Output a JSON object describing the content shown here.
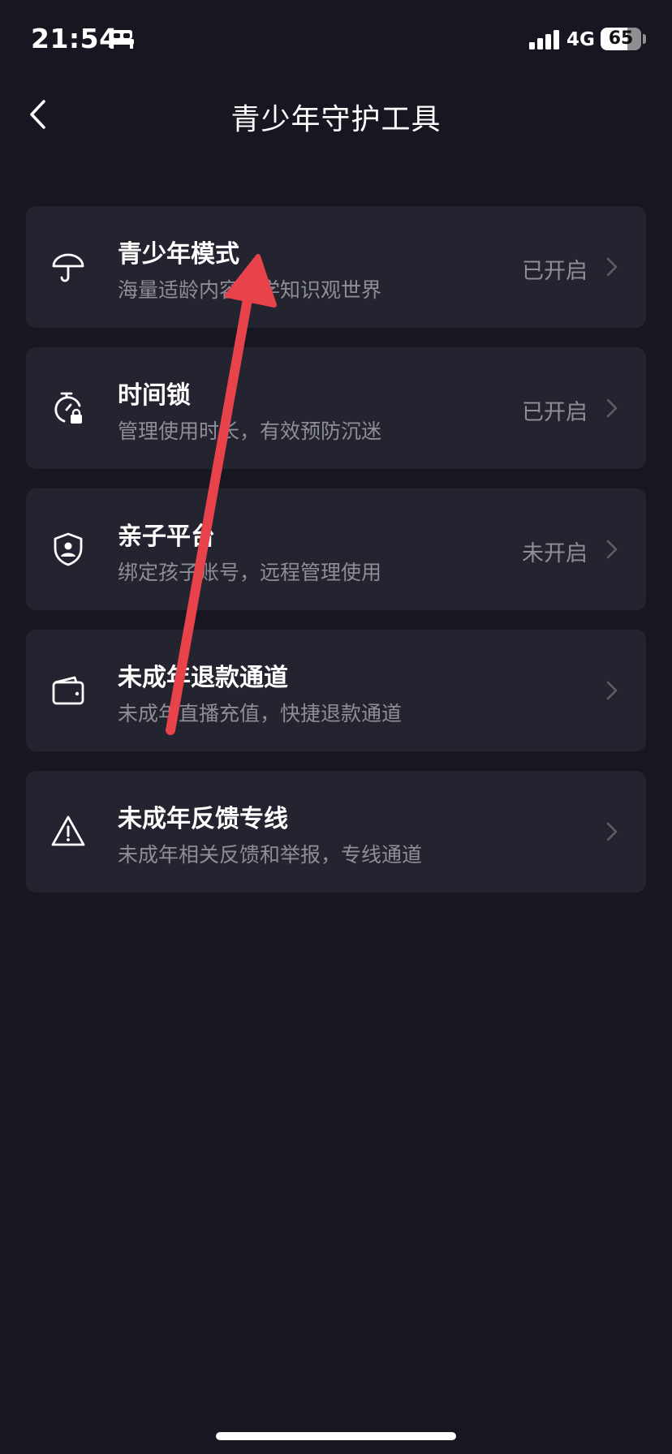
{
  "status_bar": {
    "time": "21:54",
    "network": "4G",
    "battery_level": "65",
    "battery_percent": 65,
    "icons": [
      "bed-icon",
      "cellular-signal-icon",
      "battery-icon"
    ]
  },
  "nav": {
    "back_icon": "chevron-left-icon",
    "title": "青少年守护工具"
  },
  "tools": [
    {
      "icon": "umbrella-icon",
      "title": "青少年模式",
      "description": "海量适龄内容…学知识观世界",
      "status": "已开启"
    },
    {
      "icon": "timer-lock-icon",
      "title": "时间锁",
      "description": "管理使用时长，有效预防沉迷",
      "status": "已开启"
    },
    {
      "icon": "shield-user-icon",
      "title": "亲子平台",
      "description": "绑定孩子账号，远程管理使用",
      "status": "未开启"
    },
    {
      "icon": "wallet-icon",
      "title": "未成年退款通道",
      "description": "未成年直播充值，快捷退款通道",
      "status": ""
    },
    {
      "icon": "warning-icon",
      "title": "未成年反馈专线",
      "description": "未成年相关反馈和举报，专线通道",
      "status": ""
    }
  ],
  "colors": {
    "background": "#161721",
    "card": "#23242f",
    "secondary_text": "#8d8e98",
    "annotation_arrow": "#e8434b"
  }
}
